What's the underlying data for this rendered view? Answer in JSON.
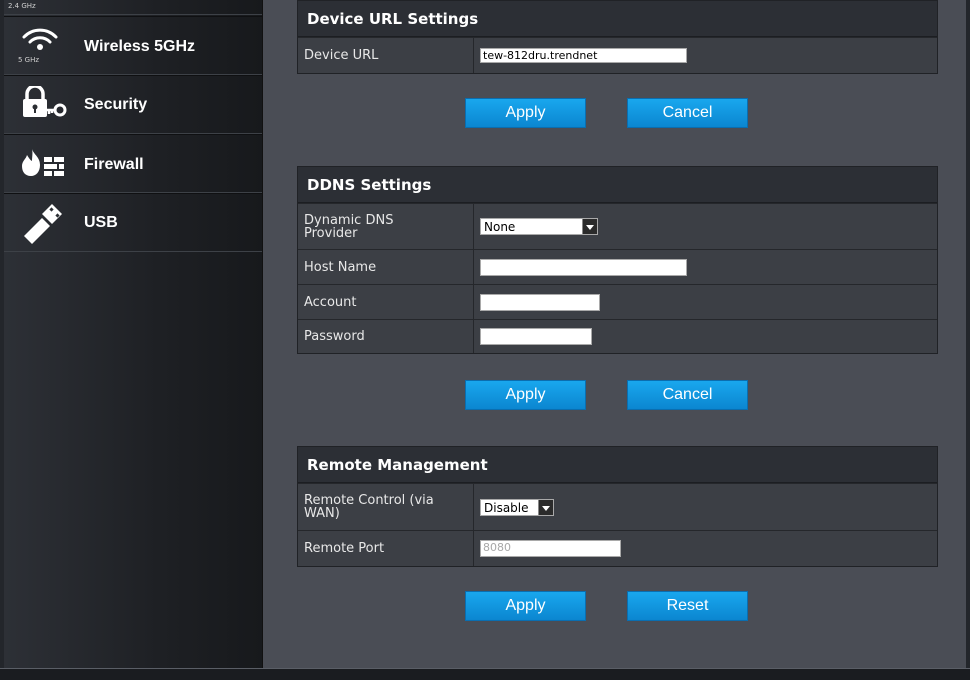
{
  "sidebar": {
    "items": [
      {
        "label": "",
        "sublabel": "2.4 GHz",
        "icon": "wifi-icon"
      },
      {
        "label": "Wireless 5GHz",
        "sublabel": "5 GHz",
        "icon": "wifi-icon"
      },
      {
        "label": "Security",
        "icon": "lock-key-icon"
      },
      {
        "label": "Firewall",
        "icon": "firewall-icon"
      },
      {
        "label": "USB",
        "icon": "usb-icon"
      }
    ]
  },
  "device_url": {
    "title": "Device URL Settings",
    "field_label": "Device URL",
    "value": "tew-812dru.trendnet",
    "apply_label": "Apply",
    "cancel_label": "Cancel"
  },
  "ddns": {
    "title": "DDNS Settings",
    "provider_label": "Dynamic DNS Provider",
    "provider_value": "None",
    "host_label": "Host Name",
    "host_value": "",
    "account_label": "Account",
    "account_value": "",
    "password_label": "Password",
    "password_value": "",
    "apply_label": "Apply",
    "cancel_label": "Cancel"
  },
  "remote": {
    "title": "Remote Management",
    "control_label": "Remote Control (via WAN)",
    "control_value": "Disable",
    "port_label": "Remote Port",
    "port_value": "8080",
    "apply_label": "Apply",
    "reset_label": "Reset"
  },
  "colors": {
    "accent": "#0b86d0",
    "panel_header": "#2c2f35",
    "background": "#4a4d55"
  }
}
